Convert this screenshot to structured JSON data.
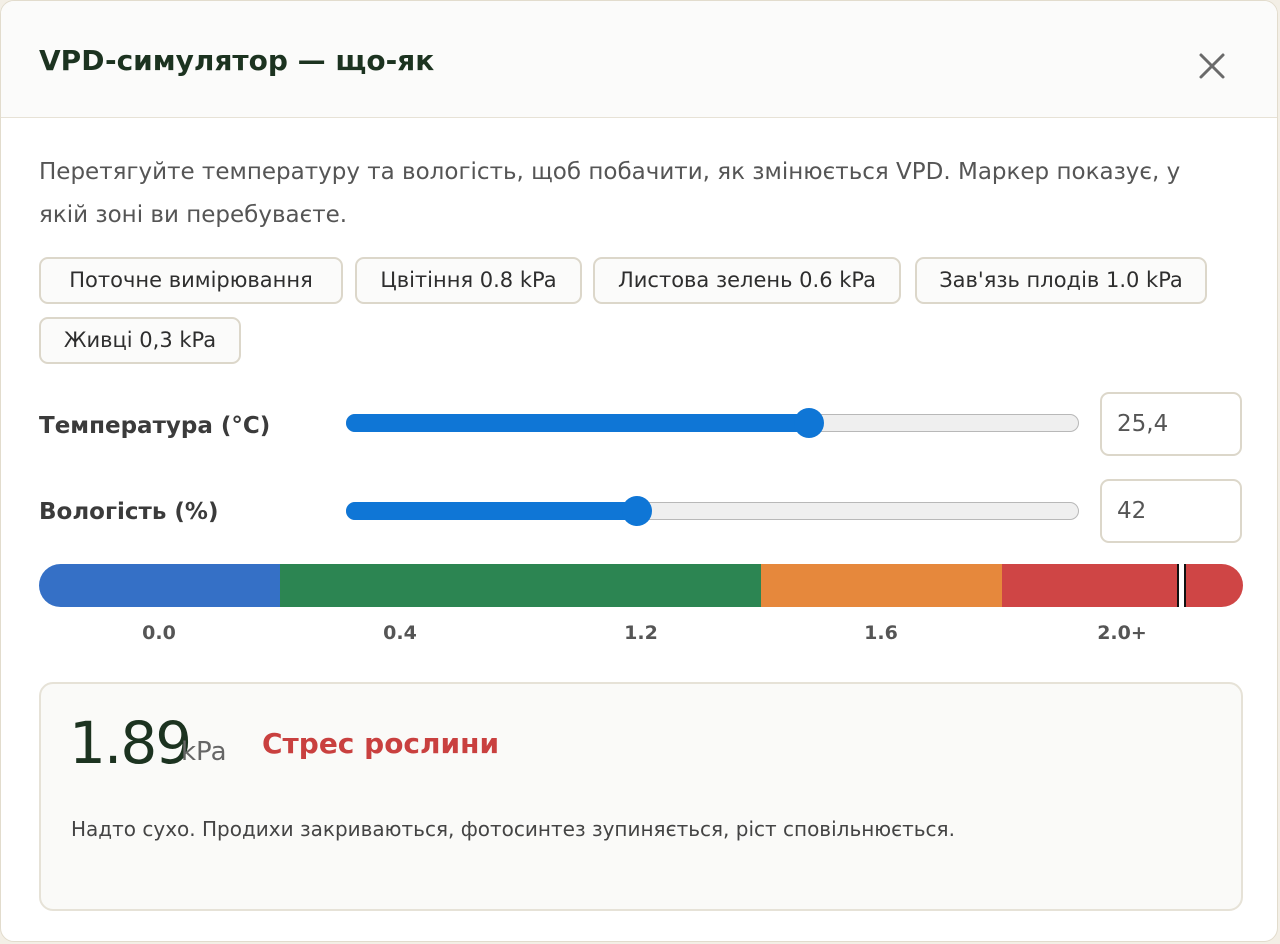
{
  "dialog": {
    "title": "VPD-симулятор — що-як",
    "close_icon": "close-icon",
    "intro": "Перетягуйте температуру та вологість, щоб побачити, як змінюється VPD. Маркер показує, у якій зоні ви перебуваєте."
  },
  "presets": [
    {
      "label": "Поточне вимірювання"
    },
    {
      "label": "Цвітіння 0.8 kPa"
    },
    {
      "label": "Листова зелень 0.6 kPa"
    },
    {
      "label": "Зав'язь плодів 1.0 kPa"
    },
    {
      "label": "Живці 0,3 kPa"
    }
  ],
  "temperature": {
    "label": "Температура (°C)",
    "value": "25,4",
    "slider_fraction": 0.63
  },
  "humidity": {
    "label": "Вологість (%)",
    "value": "42",
    "slider_fraction": 0.396
  },
  "scale": {
    "zones": [
      {
        "color": "#3570c6"
      },
      {
        "color": "#2c8552"
      },
      {
        "color": "#e6883c"
      },
      {
        "color": "#cf4545"
      }
    ],
    "ticks": [
      "0.0",
      "0.4",
      "1.2",
      "1.6",
      "2.0+"
    ],
    "marker_fraction": 0.947
  },
  "result": {
    "value": "1.89",
    "unit": "kPa",
    "status": "Стрес рослини",
    "status_color": "#c9403f",
    "description": "Надто сухо. Продихи закриваються, фотосинтез зупиняється, ріст сповільнюється."
  }
}
